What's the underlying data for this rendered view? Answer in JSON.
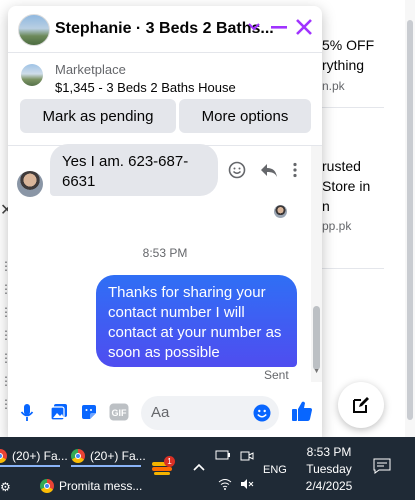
{
  "background": {
    "items": [
      {
        "line1": "5% OFF",
        "line2": "rything",
        "source": "n.pk"
      },
      {
        "line1": "rusted",
        "line2": "Store in",
        "line3": "n",
        "source": "pp.pk"
      }
    ]
  },
  "chat": {
    "title": "Stephanie · 3 Beds 2 Baths...",
    "marketplace_label": "Marketplace",
    "listing": "$1,345 - 3 Beds 2 Baths House",
    "btn_pending": "Mark as pending",
    "btn_more": "More options",
    "incoming_message": "Yes I am. 623-687-6631",
    "timestamp": "8:53 PM",
    "outgoing_message": "Thanks for sharing your contact number I will contact at your number as soon as possible",
    "sent_label": "Sent",
    "input_placeholder": "Aa"
  },
  "taskbar": {
    "tab1": "(20+) Fa...",
    "tab2": "(20+) Fa...",
    "tab3": "Promita mess...",
    "badge": "1",
    "lang": "ENG",
    "time": "8:53 PM",
    "day": "Tuesday",
    "date": "2/4/2025"
  },
  "colors": {
    "accent": "#0866ff",
    "header_icon": "#a033ff",
    "bubble_in": "#e4e6eb",
    "bubble_out_start": "#2f6ff5",
    "bubble_out_end": "#4f4df0",
    "taskbar": "#1f2a36"
  }
}
